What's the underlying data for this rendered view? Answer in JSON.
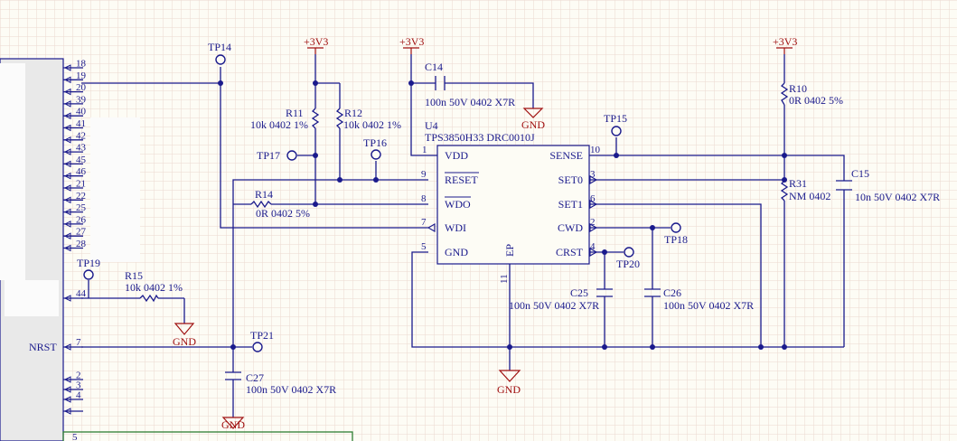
{
  "power": {
    "v3": "+3V3",
    "gnd": "GND"
  },
  "ic": {
    "ref": "U4",
    "part": "TPS3850H33 DRC0010J",
    "pins": {
      "vdd": {
        "name": "VDD",
        "num": "1"
      },
      "reset": {
        "name": "RESET",
        "num": "9"
      },
      "wdo": {
        "name": "WDO",
        "num": "8"
      },
      "wdi": {
        "name": "WDI",
        "num": "7"
      },
      "gnd": {
        "name": "GND",
        "num": "5"
      },
      "sense": {
        "name": "SENSE",
        "num": "10"
      },
      "set0": {
        "name": "SET0",
        "num": "3"
      },
      "set1": {
        "name": "SET1",
        "num": "6"
      },
      "cwd": {
        "name": "CWD",
        "num": "2"
      },
      "crst": {
        "name": "CRST",
        "num": "4"
      },
      "ep": {
        "name": "EP",
        "num": "11"
      }
    }
  },
  "components": {
    "c14": {
      "ref": "C14",
      "value": "100n 50V 0402 X7R"
    },
    "r11": {
      "ref": "R11",
      "value": "10k 0402 1%"
    },
    "r12": {
      "ref": "R12",
      "value": "10k 0402 1%"
    },
    "r14": {
      "ref": "R14",
      "value": "0R 0402 5%"
    },
    "r15": {
      "ref": "R15",
      "value": "10k 0402 1%"
    },
    "r10": {
      "ref": "R10",
      "value": "0R 0402 5%"
    },
    "r31": {
      "ref": "R31",
      "value": "NM 0402"
    },
    "c15": {
      "ref": "C15",
      "value": "10n 50V 0402 X7R"
    },
    "c25": {
      "ref": "C25",
      "value": "100n 50V 0402 X7R"
    },
    "c26": {
      "ref": "C26",
      "value": "100n 50V 0402 X7R"
    },
    "c27": {
      "ref": "C27",
      "value": "100n 50V 0402 X7R"
    }
  },
  "testpoints": [
    "TP14",
    "TP15",
    "TP16",
    "TP17",
    "TP18",
    "TP19",
    "TP20",
    "TP21"
  ],
  "net": {
    "nrst": "NRST"
  },
  "mcu_pins": {
    "top": [
      "18",
      "19",
      "20",
      "39",
      "40",
      "41",
      "42",
      "43",
      "45",
      "46",
      "21",
      "22",
      "25",
      "26",
      "27",
      "28"
    ],
    "p44": "44",
    "p7": "7",
    "bottom": [
      "2",
      "3",
      "4"
    ],
    "p5": "5"
  }
}
